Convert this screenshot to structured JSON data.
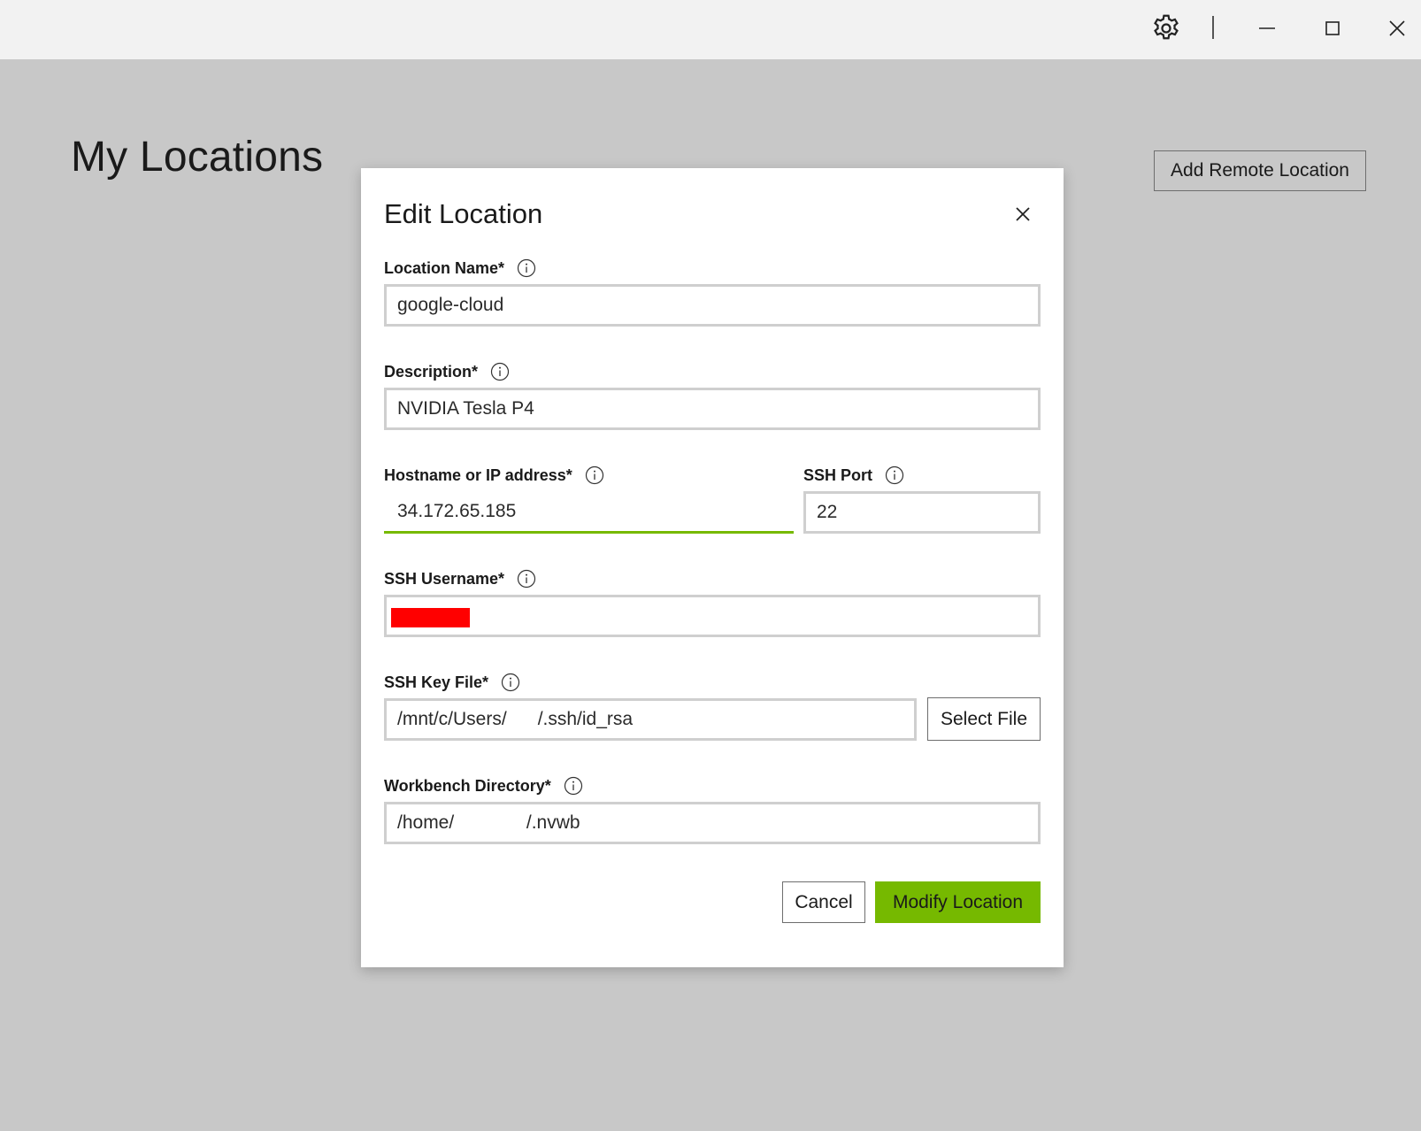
{
  "window": {
    "settings_icon": "gear-icon",
    "minimize_icon": "minimize-icon",
    "maximize_icon": "maximize-icon",
    "close_icon": "close-icon"
  },
  "page": {
    "title": "My Locations",
    "add_remote_label": "Add Remote Location"
  },
  "dialog": {
    "title": "Edit Location",
    "close_icon": "close-icon",
    "fields": {
      "location_name": {
        "label": "Location Name*",
        "value": "google-cloud"
      },
      "description": {
        "label": "Description*",
        "value": "NVIDIA Tesla P4"
      },
      "hostname": {
        "label": "Hostname or IP address*",
        "value": "34.172.65.185"
      },
      "ssh_port": {
        "label": "SSH Port",
        "value": "22"
      },
      "ssh_username": {
        "label": "SSH Username*",
        "value": ""
      },
      "ssh_key_file": {
        "label": "SSH Key File*",
        "value": "/mnt/c/Users/      /.ssh/id_rsa"
      },
      "workbench_directory": {
        "label": "Workbench Directory*",
        "value": "/home/              /.nvwb"
      }
    },
    "select_file_label": "Select File",
    "cancel_label": "Cancel",
    "submit_label": "Modify Location"
  },
  "colors": {
    "accent": "#76b900",
    "overlay_background": "#c8c8c8",
    "redaction": "#ff0000"
  }
}
